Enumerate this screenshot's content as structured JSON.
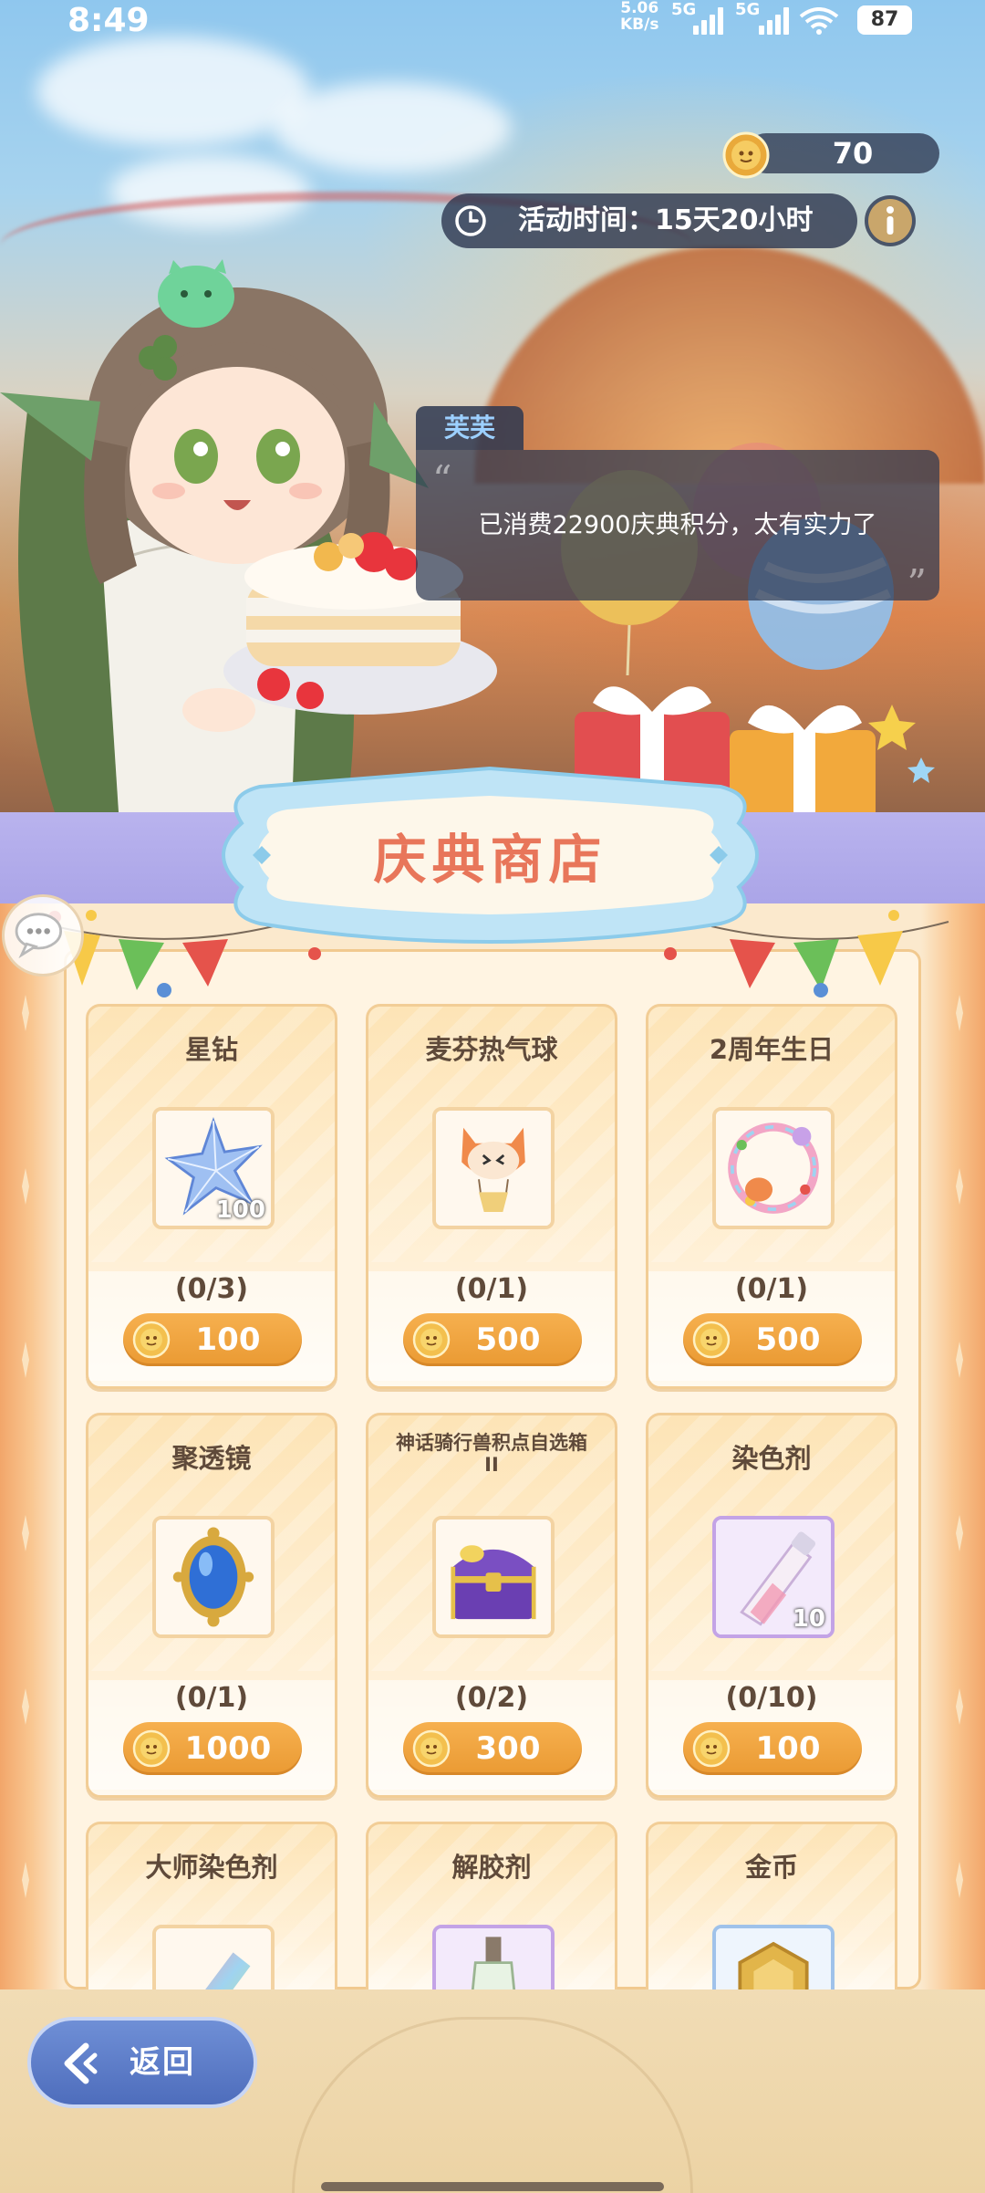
{
  "status_bar": {
    "time": "8:49",
    "net_speed_value": "5.06",
    "net_speed_unit": "KB/s",
    "sim1": "5G",
    "sim2": "5G",
    "battery": "87"
  },
  "hud": {
    "currency_amount": "70",
    "event_time_label": "活动时间：15天20小时"
  },
  "dialog": {
    "speaker": "芙芙",
    "message": "已消费22900庆典积分，太有实力了"
  },
  "shop": {
    "title": "庆典商店",
    "items": [
      {
        "name": "星钻",
        "quantity": "100",
        "stock": "(0/3)",
        "price": "100",
        "icon": "star-diamond-icon"
      },
      {
        "name": "麦芬热气球",
        "quantity": "",
        "stock": "(0/1)",
        "price": "500",
        "icon": "muffin-balloon-icon"
      },
      {
        "name": "2周年生日",
        "quantity": "",
        "stock": "(0/1)",
        "price": "500",
        "icon": "anniversary-frame-icon"
      },
      {
        "name": "聚透镜",
        "quantity": "",
        "stock": "(0/1)",
        "price": "1000",
        "icon": "lens-mirror-icon"
      },
      {
        "name": "神话骑行兽积点自选箱 II",
        "quantity": "",
        "stock": "(0/2)",
        "price": "300",
        "icon": "mount-chest-icon"
      },
      {
        "name": "染色剂",
        "quantity": "10",
        "stock": "(0/10)",
        "price": "100",
        "icon": "dye-tube-icon"
      },
      {
        "name": "大师染色剂",
        "quantity": "",
        "stock": "",
        "price": "",
        "icon": "master-dye-icon"
      },
      {
        "name": "解胶剂",
        "quantity": "",
        "stock": "",
        "price": "",
        "icon": "solvent-bottle-icon"
      },
      {
        "name": "金币",
        "quantity": "",
        "stock": "",
        "price": "",
        "icon": "gold-coin-icon"
      }
    ]
  },
  "nav": {
    "back_label": "返回"
  },
  "colors": {
    "title": "#e8765a",
    "price_button": "#ea9a33",
    "back_button": "#4e6dbc",
    "hud_bg": "#283248"
  }
}
